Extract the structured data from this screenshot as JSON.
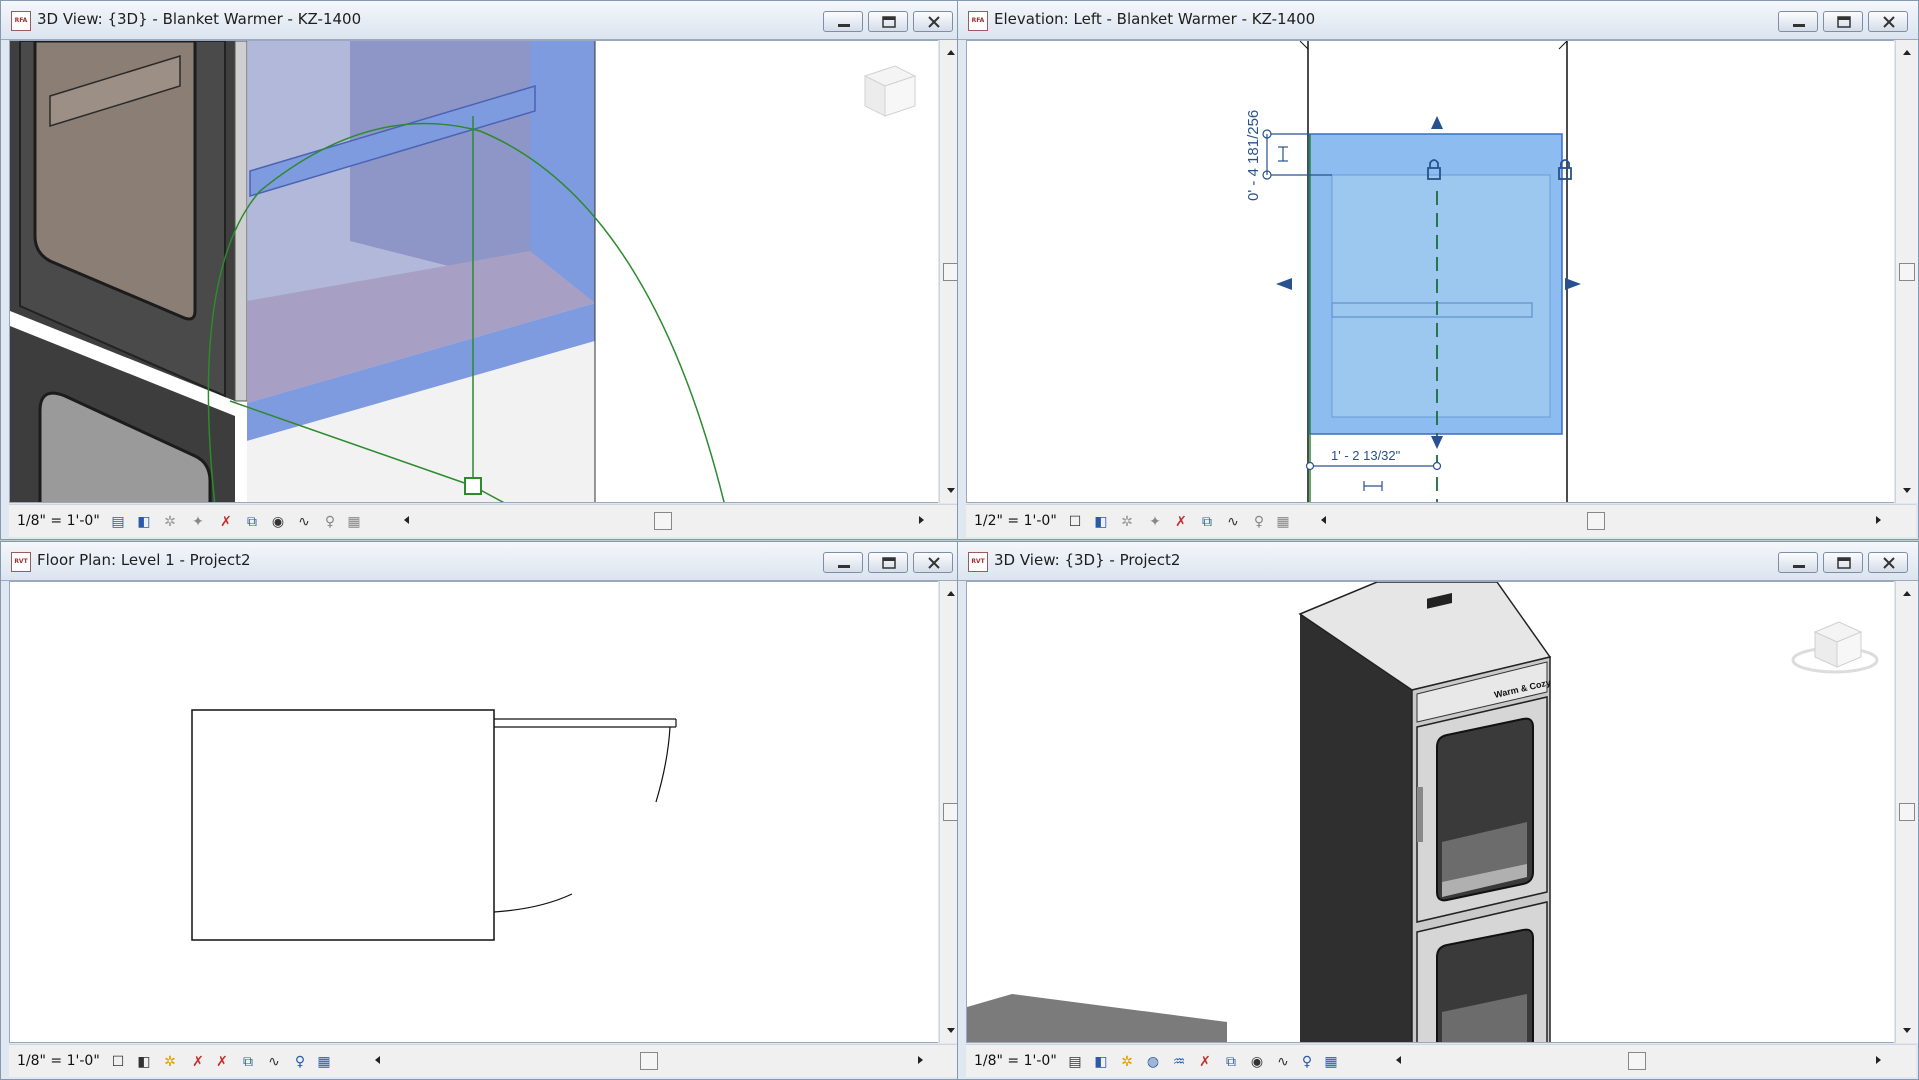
{
  "windows": [
    {
      "title": "3D View: {3D} - Blanket Warmer - KZ-1400",
      "file_badge": "RFA",
      "scale": "1/8\" = 1'-0\""
    },
    {
      "title": "Elevation: Left - Blanket Warmer - KZ-1400",
      "file_badge": "RFA",
      "scale": "1/2\" = 1'-0\"",
      "dim_vertical": "0' - 4 181/256",
      "dim_horizontal": "1' - 2 13/32\""
    },
    {
      "title": "Floor Plan: Level 1 - Project2",
      "file_badge": "RVT",
      "scale": "1/8\" = 1'-0\""
    },
    {
      "title": "3D View: {3D} - Project2",
      "file_badge": "RVT",
      "scale": "1/8\" = 1'-0\"",
      "brand_text": "Warm & Cozy"
    }
  ],
  "icons": [
    "minimize-icon",
    "restore-icon",
    "close-icon",
    "scroll-up-icon",
    "scroll-down-icon",
    "scroll-left-icon",
    "scroll-right-icon",
    "view-cube-icon"
  ],
  "colors": {
    "selection_blue": "#7f9be0",
    "elevation_selection": "#8cbcf0",
    "annotation_blue": "#27518f",
    "work_plane_green": "#2d8a2d",
    "cabinet_dark": "#3a3a3a"
  }
}
